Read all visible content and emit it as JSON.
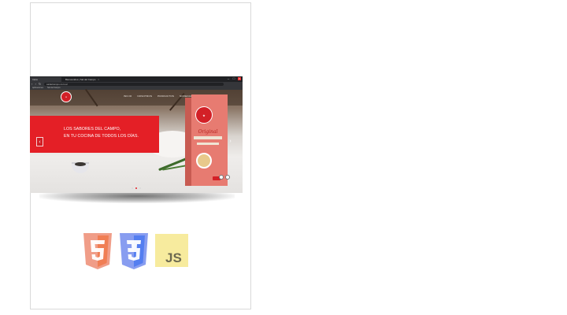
{
  "browser": {
    "tabs": [
      {
        "label": "Inicio"
      },
      {
        "label": "Bienvenidos | Sal del Campo",
        "close": "×"
      }
    ],
    "url": "saldelcampo.com.ar",
    "bookmarks": [
      "Aplicaciones",
      "Sal del Campo"
    ],
    "controls": {
      "minimize": "–",
      "maximize": "□",
      "close": "×"
    }
  },
  "site": {
    "logo_text": "Sal del Campo",
    "menu": [
      "INICIO",
      "NOSOTROS",
      "PRODUCTOS",
      "NOVEDADES"
    ],
    "hero": {
      "line1": "LOS SABORES DEL CAMPO,",
      "line2": "EN TU COCINA DE TODOS LOS DÍAS."
    },
    "product": {
      "badge": "Sal del Campo",
      "title": "Original"
    },
    "carousel": {
      "prev": "‹",
      "next": "›",
      "slides": 3,
      "active": 2
    }
  },
  "techs": [
    "html5-icon",
    "css3-icon",
    "javascript-icon"
  ],
  "colors": {
    "brand_red": "#e41f26",
    "html5": "#e44d26",
    "css3": "#264de4",
    "js": "#f0db4f"
  }
}
